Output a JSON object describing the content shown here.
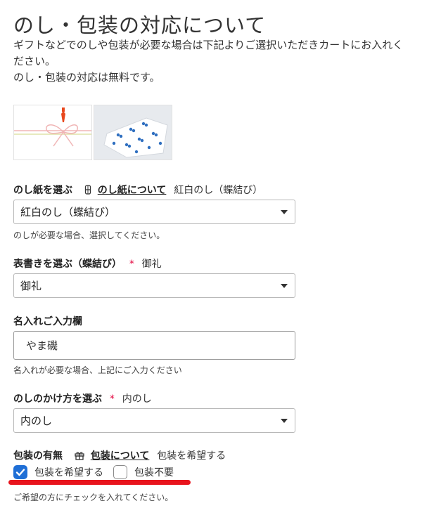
{
  "title": "のし・包装の対応について",
  "intro": {
    "line1": "ギフトなどでのしや包装が必要な場合は下記よりご選択いただきカートにお入れく",
    "line2": "ださい。",
    "line3": "のし・包装の対応は無料です。"
  },
  "noshi": {
    "label": "のし紙を選ぶ",
    "link": "のし紙について",
    "current": "紅白のし（蝶結び）",
    "value": "紅白のし（蝶結び）",
    "help": "のしが必要な場合、選択してください。"
  },
  "omote": {
    "label": "表書きを選ぶ（蝶結び）",
    "required_mark": "*",
    "current": "御礼",
    "value": "御礼"
  },
  "nairei": {
    "label": "名入れご入力欄",
    "value": "やま磯",
    "help": "名入れが必要な場合、上記にご入力ください"
  },
  "kakekata": {
    "label": "のしのかけ方を選ぶ",
    "required_mark": "*",
    "current": "内のし",
    "value": "内のし"
  },
  "wrapping": {
    "label": "包装の有無",
    "link": "包装について",
    "current": "包装を希望する",
    "option_yes": "包装を希望する",
    "option_no": "包装不要",
    "yes_checked": true,
    "no_checked": false,
    "help": "ご希望の方にチェックを入れてください。"
  },
  "colors": {
    "accent": "#1f6fd6",
    "required": "#e2003a",
    "highlight": "#e8141d"
  }
}
